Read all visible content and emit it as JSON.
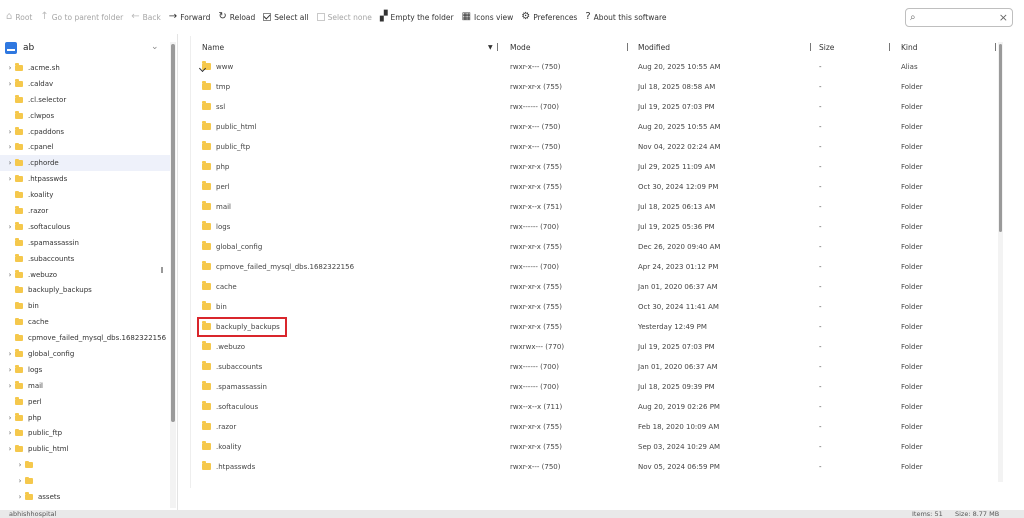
{
  "toolbar": {
    "root": "Root",
    "parent": "Go to parent folder",
    "back": "Back",
    "forward": "Forward",
    "reload": "Reload",
    "select_all": "Select all",
    "select_none": "Select none",
    "empty": "Empty the folder",
    "icons_view": "Icons view",
    "preferences": "Preferences",
    "about": "About this software",
    "search_placeholder": ""
  },
  "sidebar": {
    "drive_name": "ab",
    "items": [
      {
        "label": ".acme.sh",
        "arrow": true
      },
      {
        "label": ".caldav",
        "arrow": true
      },
      {
        "label": ".cl.selector",
        "arrow": false
      },
      {
        "label": ".clwpos",
        "arrow": false
      },
      {
        "label": ".cpaddons",
        "arrow": true
      },
      {
        "label": ".cpanel",
        "arrow": true
      },
      {
        "label": ".cphorde",
        "arrow": true,
        "selected": true
      },
      {
        "label": ".htpasswds",
        "arrow": true
      },
      {
        "label": ".koality",
        "arrow": false
      },
      {
        "label": ".razor",
        "arrow": false
      },
      {
        "label": ".softaculous",
        "arrow": true
      },
      {
        "label": ".spamassassin",
        "arrow": false
      },
      {
        "label": ".subaccounts",
        "arrow": false
      },
      {
        "label": ".webuzo",
        "arrow": true
      },
      {
        "label": "backuply_backups",
        "arrow": false
      },
      {
        "label": "bin",
        "arrow": false
      },
      {
        "label": "cache",
        "arrow": false
      },
      {
        "label": "cpmove_failed_mysql_dbs.1682322156",
        "arrow": false
      },
      {
        "label": "global_config",
        "arrow": true
      },
      {
        "label": "logs",
        "arrow": true
      },
      {
        "label": "mail",
        "arrow": true
      },
      {
        "label": "perl",
        "arrow": false
      },
      {
        "label": "php",
        "arrow": true
      },
      {
        "label": "public_ftp",
        "arrow": true
      },
      {
        "label": "public_html",
        "arrow": true
      },
      {
        "label": "",
        "arrow": true,
        "indent": 1
      },
      {
        "label": "",
        "arrow": true,
        "indent": 1
      },
      {
        "label": "assets",
        "arrow": true,
        "indent": 1
      }
    ]
  },
  "list": {
    "headers": {
      "name": "Name",
      "mode": "Mode",
      "modified": "Modified",
      "size": "Size",
      "kind": "Kind"
    },
    "rows": [
      {
        "name": "www",
        "mode": "rwxr-x--- (750)",
        "modified": "Aug 20, 2025 10:55 AM",
        "size": "-",
        "kind": "Alias",
        "alias": true
      },
      {
        "name": "tmp",
        "mode": "rwxr-xr-x (755)",
        "modified": "Jul 18, 2025 08:58 AM",
        "size": "-",
        "kind": "Folder"
      },
      {
        "name": "ssl",
        "mode": "rwx------ (700)",
        "modified": "Jul 19, 2025 07:03 PM",
        "size": "-",
        "kind": "Folder"
      },
      {
        "name": "public_html",
        "mode": "rwxr-x--- (750)",
        "modified": "Aug 20, 2025 10:55 AM",
        "size": "-",
        "kind": "Folder"
      },
      {
        "name": "public_ftp",
        "mode": "rwxr-x--- (750)",
        "modified": "Nov 04, 2022 02:24 AM",
        "size": "-",
        "kind": "Folder"
      },
      {
        "name": "php",
        "mode": "rwxr-xr-x (755)",
        "modified": "Jul 29, 2025 11:09 AM",
        "size": "-",
        "kind": "Folder"
      },
      {
        "name": "perl",
        "mode": "rwxr-xr-x (755)",
        "modified": "Oct 30, 2024 12:09 PM",
        "size": "-",
        "kind": "Folder"
      },
      {
        "name": "mail",
        "mode": "rwxr-x--x (751)",
        "modified": "Jul 18, 2025 06:13 AM",
        "size": "-",
        "kind": "Folder"
      },
      {
        "name": "logs",
        "mode": "rwx------ (700)",
        "modified": "Jul 19, 2025 05:36 PM",
        "size": "-",
        "kind": "Folder"
      },
      {
        "name": "global_config",
        "mode": "rwxr-xr-x (755)",
        "modified": "Dec 26, 2020 09:40 AM",
        "size": "-",
        "kind": "Folder"
      },
      {
        "name": "cpmove_failed_mysql_dbs.1682322156",
        "mode": "rwx------ (700)",
        "modified": "Apr 24, 2023 01:12 PM",
        "size": "-",
        "kind": "Folder"
      },
      {
        "name": "cache",
        "mode": "rwxr-xr-x (755)",
        "modified": "Jan 01, 2020 06:37 AM",
        "size": "-",
        "kind": "Folder"
      },
      {
        "name": "bin",
        "mode": "rwxr-xr-x (755)",
        "modified": "Oct 30, 2024 11:41 AM",
        "size": "-",
        "kind": "Folder"
      },
      {
        "name": "backuply_backups",
        "mode": "rwxr-xr-x (755)",
        "modified": "Yesterday 12:49 PM",
        "size": "-",
        "kind": "Folder",
        "highlighted": true
      },
      {
        "name": ".webuzo",
        "mode": "rwxrwx--- (770)",
        "modified": "Jul 19, 2025 07:03 PM",
        "size": "-",
        "kind": "Folder"
      },
      {
        "name": ".subaccounts",
        "mode": "rwx------ (700)",
        "modified": "Jan 01, 2020 06:37 AM",
        "size": "-",
        "kind": "Folder"
      },
      {
        "name": ".spamassassin",
        "mode": "rwx------ (700)",
        "modified": "Jul 18, 2025 09:39 PM",
        "size": "-",
        "kind": "Folder"
      },
      {
        "name": ".softaculous",
        "mode": "rwx--x--x (711)",
        "modified": "Aug 20, 2019 02:26 PM",
        "size": "-",
        "kind": "Folder"
      },
      {
        "name": ".razor",
        "mode": "rwxr-xr-x (755)",
        "modified": "Feb 18, 2020 10:09 AM",
        "size": "-",
        "kind": "Folder"
      },
      {
        "name": ".koality",
        "mode": "rwxr-xr-x (755)",
        "modified": "Sep 03, 2024 10:29 AM",
        "size": "-",
        "kind": "Folder"
      },
      {
        "name": ".htpasswds",
        "mode": "rwxr-x--- (750)",
        "modified": "Nov 05, 2024 06:59 PM",
        "size": "-",
        "kind": "Folder"
      }
    ]
  },
  "status": {
    "path": "abhishhospital",
    "items": "Items: 51",
    "size": "Size: 8.77 MB"
  },
  "colors": {
    "folder": "#f5c84c",
    "highlight": "#d9262c",
    "selected_row": "#eef1fa",
    "drive": "#2f78e0"
  }
}
